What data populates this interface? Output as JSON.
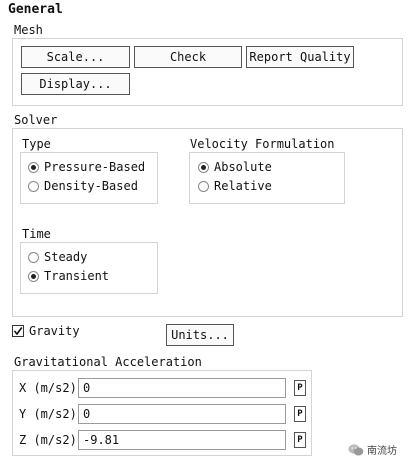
{
  "panel": {
    "title": "General"
  },
  "mesh": {
    "label": "Mesh",
    "buttons": {
      "scale": "Scale...",
      "check": "Check",
      "report": "Report Quality",
      "display": "Display..."
    }
  },
  "solver": {
    "label": "Solver",
    "type": {
      "label": "Type",
      "options": [
        {
          "label": "Pressure-Based",
          "selected": true
        },
        {
          "label": "Density-Based",
          "selected": false
        }
      ]
    },
    "velocity": {
      "label": "Velocity Formulation",
      "options": [
        {
          "label": "Absolute",
          "selected": true
        },
        {
          "label": "Relative",
          "selected": false
        }
      ]
    },
    "time": {
      "label": "Time",
      "options": [
        {
          "label": "Steady",
          "selected": false
        },
        {
          "label": "Transient",
          "selected": true
        }
      ]
    }
  },
  "gravity": {
    "label": "Gravity",
    "checked": true,
    "units_button": "Units..."
  },
  "acceleration": {
    "label": "Gravitational Acceleration",
    "rows": [
      {
        "label": "X (m/s2)",
        "value": "0",
        "param": "P"
      },
      {
        "label": "Y (m/s2)",
        "value": "0",
        "param": "P"
      },
      {
        "label": "Z (m/s2)",
        "value": "-9.81",
        "param": "P"
      }
    ]
  },
  "watermark": {
    "text": "南流坊",
    "icon": "wechat-icon"
  }
}
